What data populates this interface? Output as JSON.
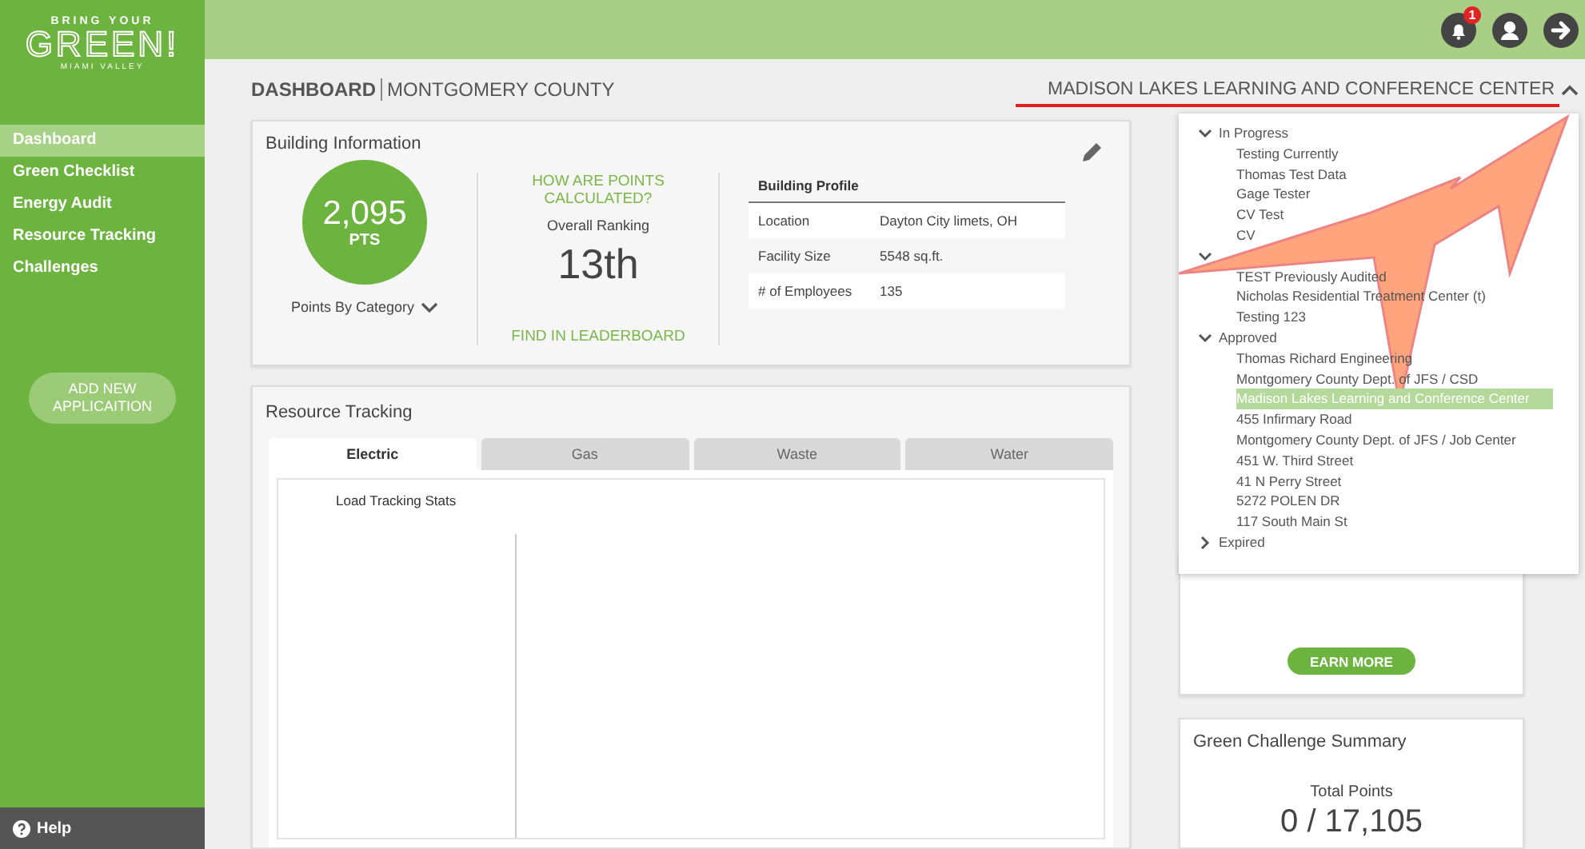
{
  "logo": {
    "top": "BRING YOUR",
    "main": "GREEN!",
    "bottom": "MIAMI VALLEY"
  },
  "top_bar": {
    "notification_count": "1"
  },
  "sidebar": {
    "items": [
      {
        "label": "Dashboard",
        "selected": true
      },
      {
        "label": "Green Checklist",
        "selected": false
      },
      {
        "label": "Energy Audit",
        "selected": false
      },
      {
        "label": "Resource Tracking",
        "selected": false
      },
      {
        "label": "Challenges",
        "selected": false
      }
    ],
    "add_button": "ADD NEW APPLICAITION",
    "help": "Help"
  },
  "header": {
    "title": "DASHBOARD",
    "subtitle": "MONTGOMERY COUNTY",
    "building": "MADISON LAKES LEARNING AND CONFERENCE CENTER",
    "menu_expanded": true
  },
  "building_info": {
    "title": "Building Information",
    "points": "2,095",
    "points_unit": "PTS",
    "points_by_category": "Points By Category",
    "how_link": "HOW ARE POINTS CALCULATED?",
    "ranking_label": "Overall Ranking",
    "ranking": "13th",
    "leaderboard_link": "FIND IN LEADERBOARD",
    "profile": {
      "title": "Building Profile",
      "rows": [
        {
          "label": "Location",
          "value": "Dayton City limets, OH"
        },
        {
          "label": "Facility Size",
          "value": "5548 sq.ft."
        },
        {
          "label": "# of Employees",
          "value": "135"
        }
      ]
    }
  },
  "resource_tracking": {
    "title": "Resource Tracking",
    "tabs": [
      {
        "label": "Electric",
        "selected": true
      },
      {
        "label": "Gas",
        "selected": false
      },
      {
        "label": "Waste",
        "selected": false
      },
      {
        "label": "Water",
        "selected": false
      }
    ],
    "chart_title": "Load Tracking Stats"
  },
  "building_menu": {
    "groups": [
      {
        "label": "In Progress",
        "expanded": true,
        "items": [
          {
            "label": "Testing Currently",
            "selected": false
          },
          {
            "label": "Thomas Test Data",
            "selected": false
          },
          {
            "label": "Gage Tester",
            "selected": false
          },
          {
            "label": "CV Test",
            "selected": false
          },
          {
            "label": "CV",
            "selected": false
          }
        ]
      },
      {
        "expanded": true,
        "items": [
          {
            "label": "TEST Previously Audited",
            "selected": false
          },
          {
            "label": "Nicholas Residential Treatment Center (t)",
            "selected": false
          },
          {
            "label": "Testing 123",
            "selected": false
          }
        ]
      },
      {
        "label": "Approved",
        "expanded": true,
        "items": [
          {
            "label": "Thomas Richard Engineering",
            "selected": false
          },
          {
            "label": "Montgomery County Dept. of JFS / CSD",
            "selected": false
          },
          {
            "label": "Madison Lakes Learning and Conference Center",
            "selected": true
          },
          {
            "label": "455 Infirmary Road",
            "selected": false
          },
          {
            "label": "Montgomery County Dept. of JFS / Job Center",
            "selected": false
          },
          {
            "label": "451 W. Third Street",
            "selected": false
          },
          {
            "label": "41 N Perry Street",
            "selected": false
          },
          {
            "label": "5272 POLEN DR",
            "selected": false
          },
          {
            "label": "117 South Main St",
            "selected": false
          }
        ]
      },
      {
        "label": "Expired",
        "expanded": false
      }
    ]
  },
  "earn_more": "EARN MORE",
  "challenge": {
    "title": "Green Challenge Summary",
    "total_label": "Total Points",
    "total": "0 / 17,105"
  }
}
